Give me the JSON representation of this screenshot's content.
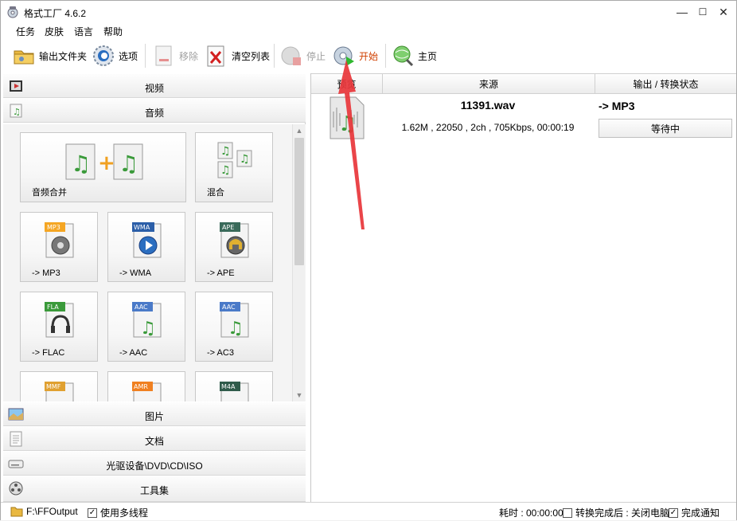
{
  "window": {
    "title": "格式工厂 4.6.2",
    "controls": {
      "minimize": "—",
      "maximize": "☐",
      "close": "✕"
    }
  },
  "menu": [
    "任务",
    "皮肤",
    "语言",
    "帮助"
  ],
  "toolbar": {
    "output_folder": "输出文件夹",
    "options": "选项",
    "remove": "移除",
    "clear_list": "清空列表",
    "stop": "停止",
    "start": "开始",
    "home": "主页"
  },
  "categories": {
    "video": "视频",
    "audio": "音频",
    "picture": "图片",
    "document": "文档",
    "disc": "光驱设备\\DVD\\CD\\ISO",
    "tools": "工具集"
  },
  "audio_tiles": [
    {
      "label": "音频合并",
      "badge": ""
    },
    {
      "label": "混合",
      "badge": ""
    },
    {
      "label": "-> MP3",
      "badge": "MP3"
    },
    {
      "label": "-> WMA",
      "badge": "WMA"
    },
    {
      "label": "-> APE",
      "badge": "APE"
    },
    {
      "label": "-> FLAC",
      "badge": "FLA"
    },
    {
      "label": "-> AAC",
      "badge": "AAC"
    },
    {
      "label": "-> AC3",
      "badge": "AAC"
    },
    {
      "label": "",
      "badge": "MMF"
    },
    {
      "label": "",
      "badge": "AMR"
    },
    {
      "label": "",
      "badge": "M4A"
    }
  ],
  "task_table": {
    "headers": [
      "预览",
      "来源",
      "输出 / 转换状态"
    ],
    "rows": [
      {
        "file_name": "11391.wav",
        "meta": "1.62M , 22050 , 2ch , 705Kbps, 00:00:19",
        "output": "-> MP3",
        "status": "等待中"
      }
    ]
  },
  "statusbar": {
    "output_path": "F:\\FFOutput",
    "multithread": "使用多线程",
    "multithread_checked": true,
    "elapsed": "耗时 : 00:00:00",
    "after_convert": "转换完成后 : 关闭电脑",
    "after_convert_checked": false,
    "notify": "完成通知",
    "notify_checked": true
  },
  "colors": {
    "accent_arrow": "#e8353a",
    "badge_orange": "#f5a623",
    "badge_blue": "#2b5ea8",
    "badge_gray": "#8a8a8a",
    "badge_green": "#3a9a3a",
    "badge_dark": "#2f5b4a"
  }
}
